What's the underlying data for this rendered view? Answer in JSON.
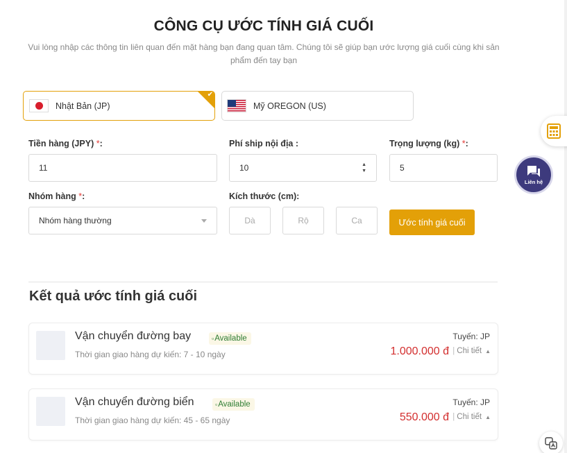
{
  "header": {
    "title": "CÔNG CỤ ƯỚC TÍNH GIÁ CUỐI",
    "subtitle": "Vui lòng nhập các thông tin liên quan đến mặt hàng bạn đang quan tâm. Chúng tôi sẽ giúp bạn ước lượng giá cuối cùng khi sản phẩm đến tay bạn"
  },
  "countries": [
    {
      "label": "Nhật Bản (JP)",
      "flag": "japan-flag",
      "selected": true
    },
    {
      "label": "Mỹ OREGON (US)",
      "flag": "usa-flag",
      "selected": false
    }
  ],
  "form": {
    "price": {
      "label": "Tiền hàng (JPY)",
      "value": "11"
    },
    "domestic_ship": {
      "label": "Phí ship nội địa :",
      "value": "10"
    },
    "weight": {
      "label": "Trọng lượng (kg)",
      "value": "5"
    },
    "category": {
      "label": "Nhóm hàng",
      "value": "Nhóm hàng thường"
    },
    "size": {
      "label": "Kích thước (cm):",
      "length_placeholder": "Dà",
      "width_placeholder": "Rộ",
      "height_placeholder": "Ca"
    },
    "required_mark": "*",
    "colon": ":",
    "submit_label": "Ước tính giá cuối"
  },
  "results": {
    "heading": "Kết quả ước tính giá cuối",
    "items": [
      {
        "name": "Vận chuyển đường bay",
        "badge": "Available",
        "eta": "Thời gian giao hàng dự kiến: 7 - 10 ngày",
        "route": "Tuyến: JP",
        "price": "1.000.000 đ",
        "detail": "Chi tiết"
      },
      {
        "name": "Vận chuyển đường biển",
        "badge": "Available",
        "eta": "Thời gian giao hàng dự kiến: 45 - 65 ngày",
        "route": "Tuyến: JP",
        "price": "550.000 đ",
        "detail": "Chi tiết"
      }
    ]
  },
  "floating": {
    "contact_label": "Liên hệ",
    "calculator_icon": "calculator-icon",
    "contact_icon": "chat-icon",
    "translate_icon": "translate-icon"
  },
  "colors": {
    "accent": "#e3a008",
    "price": "#d32f2f",
    "available": "#2e7d32",
    "contact": "#3d3a7d"
  }
}
